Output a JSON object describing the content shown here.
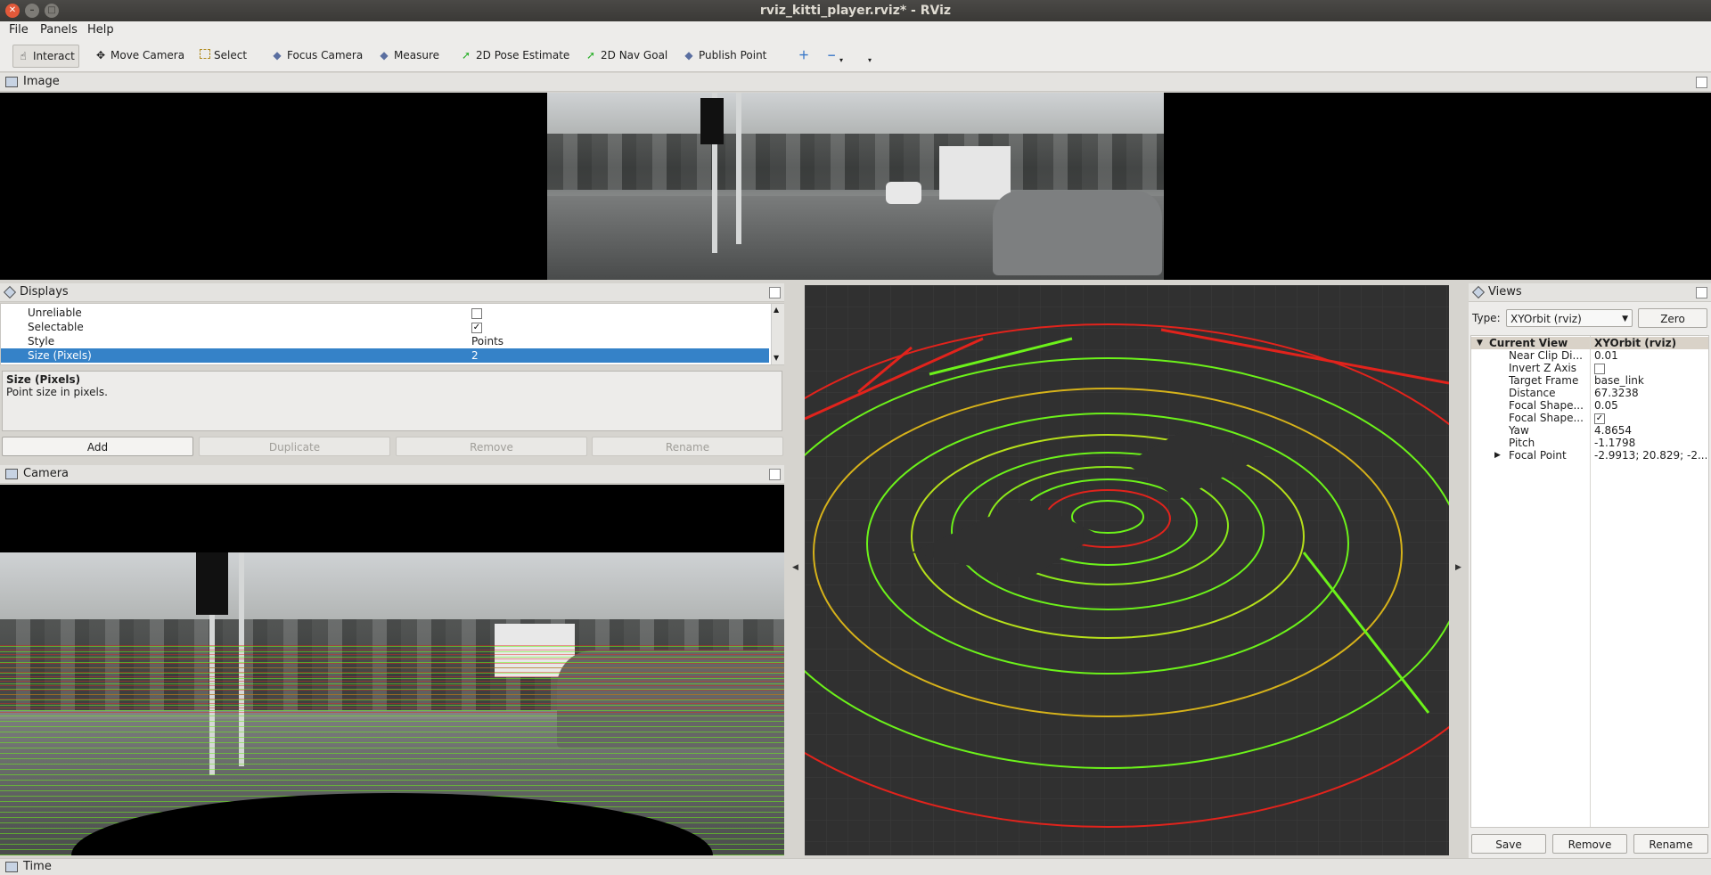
{
  "window": {
    "title": "rviz_kitti_player.rviz* - RViz"
  },
  "menu": {
    "file": "File",
    "panels": "Panels",
    "help": "Help"
  },
  "toolbar": {
    "interact": "Interact",
    "move_camera": "Move Camera",
    "select": "Select",
    "focus_camera": "Focus Camera",
    "measure": "Measure",
    "pose_estimate": "2D Pose Estimate",
    "nav_goal": "2D Nav Goal",
    "publish_point": "Publish Point"
  },
  "image_panel": {
    "title": "Image"
  },
  "displays": {
    "title": "Displays",
    "rows": [
      {
        "key": "Unreliable",
        "value": ""
      },
      {
        "key": "Selectable",
        "value": "✓"
      },
      {
        "key": "Style",
        "value": "Points"
      },
      {
        "key": "Size (Pixels)",
        "value": "2"
      }
    ],
    "desc_title": "Size (Pixels)",
    "desc_text": "Point size in pixels.",
    "buttons": {
      "add": "Add",
      "duplicate": "Duplicate",
      "remove": "Remove",
      "rename": "Rename"
    }
  },
  "camera_panel": {
    "title": "Camera"
  },
  "views": {
    "title": "Views",
    "type_label": "Type:",
    "type_value": "XYOrbit (rviz)",
    "zero": "Zero",
    "current_view": {
      "key": "Current View",
      "value": "XYOrbit (rviz)"
    },
    "props": [
      {
        "key": "Near Clip Di...",
        "value": "0.01"
      },
      {
        "key": "Invert Z Axis",
        "value": ""
      },
      {
        "key": "Target Frame",
        "value": "base_link"
      },
      {
        "key": "Distance",
        "value": "67.3238"
      },
      {
        "key": "Focal Shape...",
        "value": "0.05"
      },
      {
        "key": "Focal Shape...",
        "value": "✓"
      },
      {
        "key": "Yaw",
        "value": "4.8654"
      },
      {
        "key": "Pitch",
        "value": "-1.1798"
      },
      {
        "key": "Focal Point",
        "value": "-2.9913; 20.829; -2..."
      }
    ],
    "buttons": {
      "save": "Save",
      "remove": "Remove",
      "rename": "Rename"
    }
  },
  "time_panel": {
    "title": "Time"
  },
  "colors": {
    "selection": "#3582c8",
    "point_green": "#6cf21a",
    "point_red": "#e2231c",
    "grid_bg": "#303030"
  }
}
